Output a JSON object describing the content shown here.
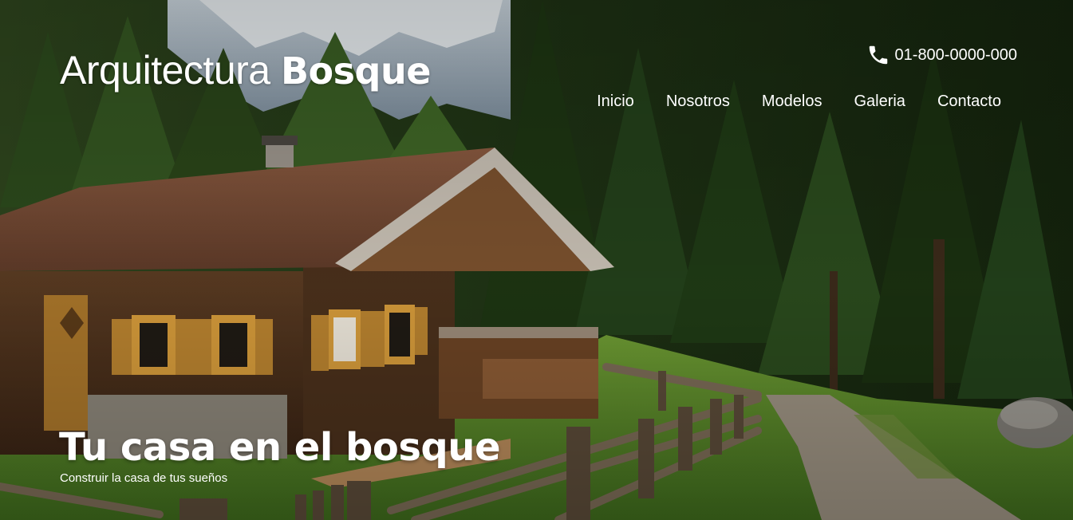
{
  "header": {
    "logo_light": "Arquitectura ",
    "logo_bold": "Bosque",
    "phone_icon": "phone-icon",
    "phone_number": "01-800-0000-000"
  },
  "nav": {
    "items": [
      {
        "label": "Inicio"
      },
      {
        "label": "Nosotros"
      },
      {
        "label": "Modelos"
      },
      {
        "label": "Galeria"
      },
      {
        "label": "Contacto"
      }
    ]
  },
  "hero": {
    "title": "Tu casa en el bosque",
    "subtitle": "Construir la casa de tus sueños"
  },
  "colors": {
    "text": "#ffffff",
    "forest_dark": "#1d2a14",
    "grass": "#5b8a2a",
    "roof": "#7a4a33",
    "wood": "#5a3a22"
  }
}
